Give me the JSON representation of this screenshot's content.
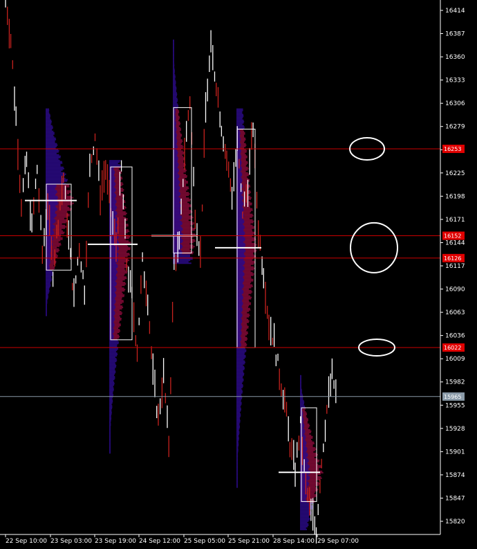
{
  "chart_data": {
    "type": "candlestick",
    "y_ticks": [
      16414,
      16387,
      16360,
      16333,
      16306,
      16279,
      16252,
      16225,
      16198,
      16171,
      16144,
      16117,
      16090,
      16063,
      16036,
      16009,
      15982,
      15955,
      15928,
      15901,
      15874,
      15847,
      15820
    ],
    "x_ticks": [
      "22 Sep 10:00",
      "23 Sep 03:00",
      "23 Sep 19:00",
      "24 Sep 12:00",
      "25 Sep 05:00",
      "25 Sep 21:00",
      "28 Sep 14:00",
      "29 Sep 07:00"
    ],
    "horizontal_levels": [
      {
        "value": 16253,
        "label": "16253",
        "color": "#cc0000",
        "highlight": "#e00000"
      },
      {
        "value": 16152,
        "label": "16152",
        "color": "#cc0000",
        "highlight": "#e00000"
      },
      {
        "value": 16126,
        "label": "16126",
        "color": "#cc0000",
        "highlight": "#e00000"
      },
      {
        "value": 16022,
        "label": "16022",
        "color": "#cc0000",
        "highlight": "#e00000"
      },
      {
        "value": 15965,
        "label": "15965",
        "color": "#8a9aa8",
        "highlight": "#8a9aa8"
      }
    ],
    "price_path": [
      16430,
      16380,
      16290,
      16190,
      16240,
      16160,
      16230,
      16130,
      16190,
      16110,
      16170,
      16220,
      16150,
      16080,
      16140,
      16090,
      16230,
      16270,
      16200,
      16230,
      16180,
      16140,
      16230,
      16120,
      16080,
      16020,
      16120,
      16080,
      15990,
      15940,
      15990,
      15910,
      16120,
      16140,
      16250,
      16310,
      16180,
      16130,
      16300,
      16370,
      16330,
      16280,
      16240,
      16200,
      16260,
      16180,
      16210,
      16280,
      16160,
      16110,
      16050,
      16030,
      15990,
      15960,
      15910,
      15880,
      15930,
      15860,
      15830,
      15810,
      15890,
      15950,
      15990,
      15960
    ],
    "value_areas": [
      {
        "day": "22 Sep",
        "vah": 16212,
        "val": 16112,
        "poc": 16193
      },
      {
        "day": "23 Sep",
        "vah": 16232,
        "val": 16031,
        "poc": 16142
      },
      {
        "day": "24 Sep",
        "vah": 16301,
        "val": 16132,
        "poc": 16152
      },
      {
        "day": "25 Sep",
        "vah": 16276,
        "val": 16022,
        "poc": 16138
      },
      {
        "day": "28 Sep",
        "vah": 15952,
        "val": 15843,
        "poc": 15877
      }
    ],
    "annotations": [
      "ellipse at 16253",
      "ellipse at 16138",
      "ellipse at 16022"
    ],
    "grid": false,
    "colors": {
      "bg": "#000000",
      "bear": "#c8221e",
      "bull": "#ffffff",
      "profile_low": "#2b0a8a",
      "profile_high": "#8a0a3a",
      "axis": "#ffffff"
    }
  }
}
